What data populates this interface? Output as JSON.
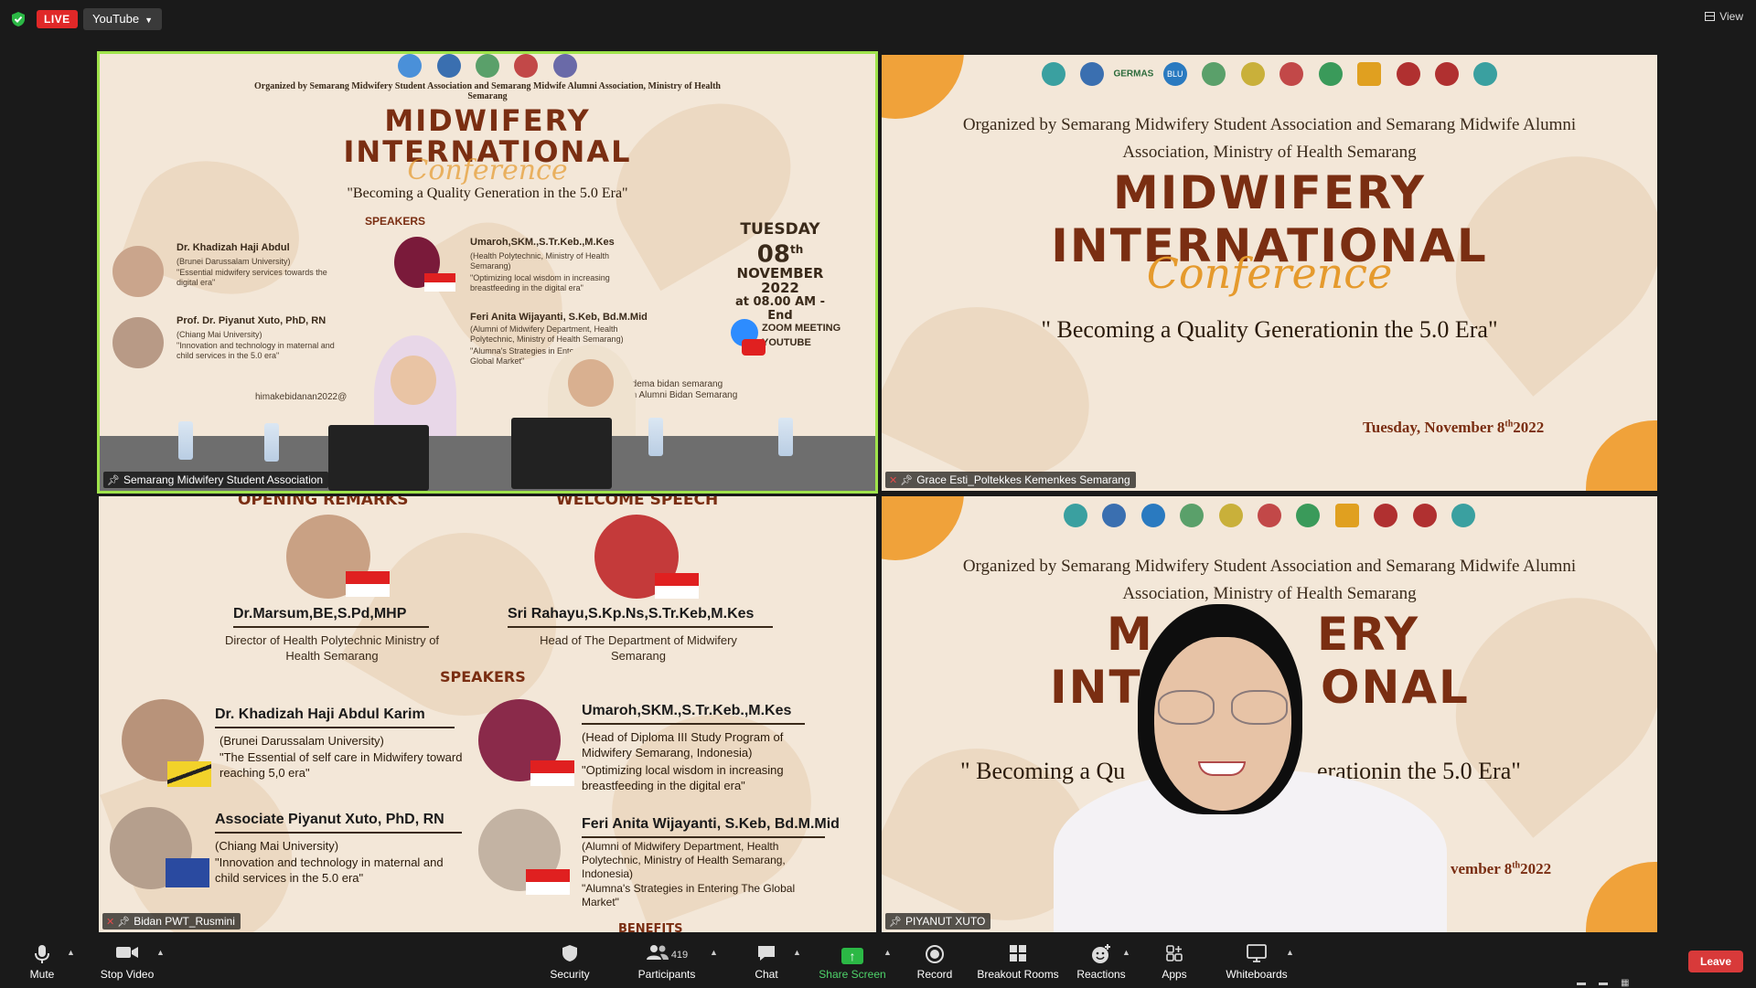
{
  "top_bar": {
    "live_label": "LIVE",
    "stream_target": "YouTube",
    "view_label": "View"
  },
  "tiles": [
    {
      "participant": "Semarang Midwifery Student Association",
      "organizer_line": "Organized by Semarang Midwifery Student Association and Semarang Midwife Alumni Association, Ministry of Health Semarang",
      "title_line1": "MIDWIFERY",
      "title_line2": "INTERNATIONAL",
      "script": "Conference",
      "tagline": "\"Becoming a Quality Generation in the 5.0 Era\"",
      "speakers_heading": "SPEAKERS",
      "speakers": [
        {
          "name": "Dr. Khadizah Haji Abdul",
          "affiliation": "(Brunei Darussalam University)",
          "topic": "\"Essential midwifery services towards the digital era\""
        },
        {
          "name": "Prof. Dr. Piyanut Xuto, PhD, RN",
          "affiliation": "(Chiang Mai University)",
          "topic": "\"Innovation and technology in maternal and child services in the 5.0 era\""
        },
        {
          "name": "Umaroh,SKM.,S.Tr.Keb.,M.Kes",
          "affiliation": "(Health Polytechnic, Ministry of Health Semarang)",
          "topic": "\"Optimizing local wisdom in increasing breastfeeding in the digital era\""
        },
        {
          "name": "Feri Anita Wijayanti, S.Keb, Bd.M.Mid",
          "affiliation": "(Alumni of Midwifery Department, Health Polytechnic, Ministry of Health Semarang)",
          "topic": "\"Alumna's Strategies in Entering The Global Market\""
        }
      ],
      "day": "TUESDAY",
      "date_num": "08",
      "date_sup": "th",
      "month_year": "NOVEMBER 2022",
      "time": "at 08.00 AM - End",
      "platform1": "ZOOM MEETING",
      "platform2": "YOUTUBE",
      "email": "himakebidanan2022@",
      "instagram1": "himadema bidan semarang",
      "instagram2": "Ikatan Alumni Bidan Semarang"
    },
    {
      "participant": "Grace Esti_Poltekkes Kemenkes Semarang",
      "logo_text": "GERMAS",
      "logo_text2": "BLU",
      "organizer_line1": "Organized by Semarang Midwifery Student Association and Semarang Midwife Alumni",
      "organizer_line2": "Association, Ministry of Health Semarang",
      "title_line1": "MIDWIFERY",
      "title_line2": "INTERNATIONAL",
      "script": "Conference",
      "tagline": "\" Becoming a Quality Generationin the 5.0 Era\"",
      "date": "Tuesday, November 8",
      "date_sup": "th",
      "date_year": "2022"
    },
    {
      "participant": "Bidan PWT_Rusmini",
      "opening_heading": "OPENING REMARKS",
      "welcome_heading": "WELCOME SPEECH",
      "opening_name": "Dr.Marsum,BE,S.Pd,MHP",
      "opening_role": "Director of Health Polytechnic Ministry of Health Semarang",
      "welcome_name": "Sri Rahayu,S.Kp.Ns,S.Tr.Keb,M.Kes",
      "welcome_role": "Head of The Department of Midwifery Semarang",
      "speakers_heading": "SPEAKERS",
      "speakers": [
        {
          "name": "Dr. Khadizah Haji Abdul Karim",
          "affiliation": "(Brunei Darussalam University)",
          "topic": "\"The Essential of self care in Midwifery toward reaching 5,0 era\""
        },
        {
          "name": "Associate Piyanut Xuto, PhD, RN",
          "affiliation": "(Chiang Mai University)",
          "topic": "\"Innovation and technology in maternal and child services in the 5.0 era\""
        },
        {
          "name": "Umaroh,SKM.,S.Tr.Keb.,M.Kes",
          "affiliation": "(Head of Diploma III Study Program of Midwifery Semarang, Indonesia)",
          "topic": "\"Optimizing local wisdom in increasing breastfeeding in the digital era\""
        },
        {
          "name": "Feri Anita Wijayanti, S.Keb, Bd.M.Mid",
          "affiliation": "(Alumni of Midwifery Department, Health Polytechnic, Ministry of Health Semarang, Indonesia)",
          "topic": "\"Alumna's Strategies in Entering The Global Market\""
        }
      ],
      "benefits": "BENEFITS"
    },
    {
      "participant": "PIYANUT XUTO",
      "organizer_line1": "Organized by Semarang Midwifery Student Association and Semarang Midwife Alumni",
      "organizer_line2": "Association, Ministry of Health Semarang",
      "title_line1_left": "M",
      "title_line1_right": "ERY",
      "title_line2_left": "INT",
      "title_line2_right": "ONAL",
      "script": "rence",
      "tagline_left": "\" Becoming a Qu",
      "tagline_right": "erationin the 5.0 Era\"",
      "date": "vember 8",
      "date_sup": "th",
      "date_year": "2022"
    }
  ],
  "toolbar": {
    "mute": "Mute",
    "stop_video": "Stop Video",
    "security": "Security",
    "participants": "Participants",
    "participant_count": "419",
    "chat": "Chat",
    "share_screen": "Share Screen",
    "record": "Record",
    "breakout_rooms": "Breakout Rooms",
    "reactions": "Reactions",
    "apps": "Apps",
    "whiteboards": "Whiteboards",
    "leave": "Leave"
  },
  "colors": {
    "live_red": "#e02828",
    "active_speaker_border": "#9fe34b",
    "share_green": "#2bb845",
    "leave_red": "#d83a3a",
    "poster_brown": "#7a2e12",
    "poster_orange": "#e59a2d"
  },
  "icons": [
    "shield-icon",
    "grid-view-icon",
    "microphone-icon",
    "video-camera-icon",
    "security-shield-icon",
    "participants-icon",
    "chat-bubble-icon",
    "share-screen-icon",
    "record-icon",
    "breakout-rooms-icon",
    "reactions-icon",
    "apps-icon",
    "whiteboard-icon",
    "pin-icon",
    "muted-mic-icon"
  ]
}
